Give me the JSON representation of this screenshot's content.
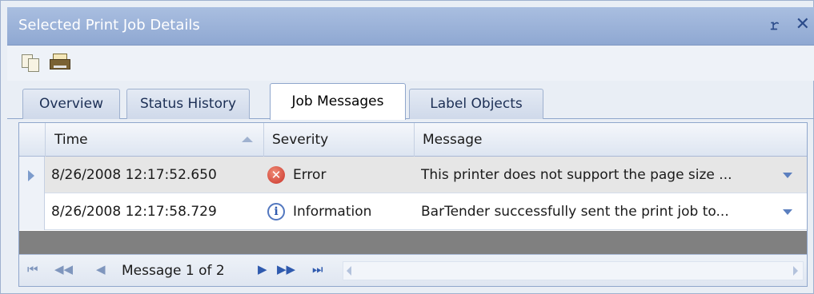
{
  "window": {
    "title": "Selected Print Job Details",
    "pin_glyph": "ᵘ",
    "close_glyph": "✕"
  },
  "toolbar": {
    "buttons": [
      {
        "name": "copy",
        "icon": "copy-icon"
      },
      {
        "name": "print",
        "icon": "printer-icon"
      }
    ]
  },
  "tabs": [
    {
      "label": "Overview",
      "active": false
    },
    {
      "label": "Status History",
      "active": false
    },
    {
      "label": "Job Messages",
      "active": true
    },
    {
      "label": "Label Objects",
      "active": false
    }
  ],
  "grid": {
    "columns": [
      "Time",
      "Severity",
      "Message"
    ],
    "sorted_column": "Time",
    "rows": [
      {
        "time": "8/26/2008 12:17:52.650",
        "severity": "Error",
        "severity_icon": "error-icon",
        "message": "This printer does not support the page size ...",
        "selected": true
      },
      {
        "time": "8/26/2008 12:17:58.729",
        "severity": "Information",
        "severity_icon": "info-icon",
        "message": "BarTender successfully sent the print job to...",
        "selected": false
      }
    ]
  },
  "navigator": {
    "status_text": "Message 1 of 2",
    "glyphs": {
      "first": "⏮",
      "prev_page": "◀◀",
      "prev": "◀",
      "next": "▶",
      "next_page": "▶▶",
      "last": "⏭"
    }
  },
  "colors": {
    "title_bar": "#a9bee0",
    "accent": "#2f5aae",
    "error": "#c9332a",
    "selected_row": "#e6e6e6",
    "grid_filler": "#808080"
  }
}
